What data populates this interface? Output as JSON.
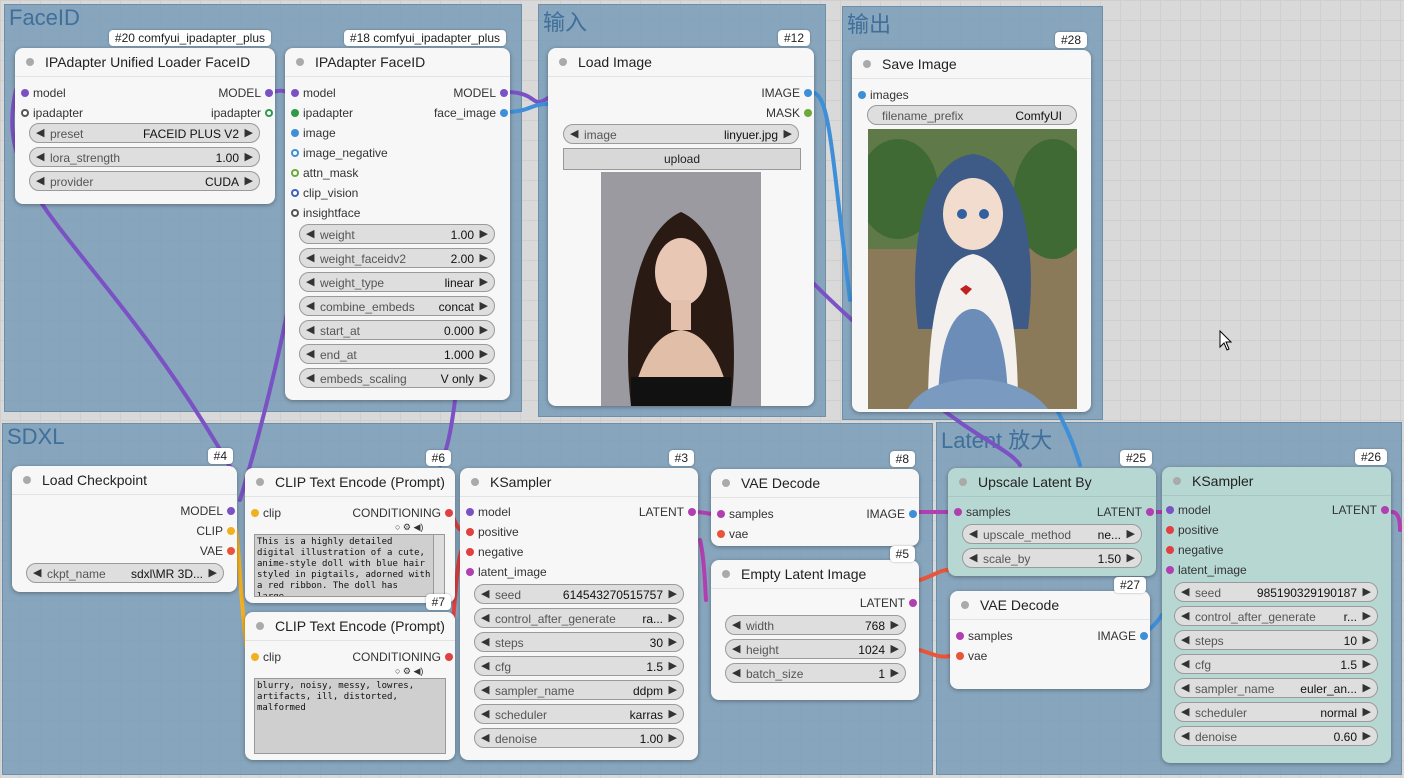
{
  "groups": {
    "faceid": "FaceID",
    "input": "输入",
    "output": "输出",
    "sdxl": "SDXL",
    "latent": "Latent 放大"
  },
  "colors": {
    "model": "#7b52c4",
    "ipadapter": "#2e9a4a",
    "image": "#3e8fd8",
    "clip": "#f0b020",
    "vae": "#e8553a",
    "conditioning": "#e04040",
    "latent": "#b040b0",
    "mask": "#6aaa3a"
  },
  "loader": {
    "badge": "#20 comfyui_ipadapter_plus",
    "title": "IPAdapter Unified Loader FaceID",
    "in_model": "model",
    "in_ipadapter": "ipadapter",
    "out_model": "MODEL",
    "out_ipadapter": "ipadapter",
    "w": [
      {
        "label": "preset",
        "value": "FACEID PLUS V2"
      },
      {
        "label": "lora_strength",
        "value": "1.00"
      },
      {
        "label": "provider",
        "value": "CUDA"
      }
    ]
  },
  "faceid": {
    "badge": "#18 comfyui_ipadapter_plus",
    "title": "IPAdapter FaceID",
    "inputs": [
      "model",
      "ipadapter",
      "image",
      "image_negative",
      "attn_mask",
      "clip_vision",
      "insightface"
    ],
    "out_model": "MODEL",
    "out_face": "face_image",
    "w": [
      {
        "label": "weight",
        "value": "1.00"
      },
      {
        "label": "weight_faceidv2",
        "value": "2.00"
      },
      {
        "label": "weight_type",
        "value": "linear"
      },
      {
        "label": "combine_embeds",
        "value": "concat"
      },
      {
        "label": "start_at",
        "value": "0.000"
      },
      {
        "label": "end_at",
        "value": "1.000"
      },
      {
        "label": "embeds_scaling",
        "value": "V only"
      }
    ]
  },
  "load_image": {
    "badge": "#12",
    "title": "Load Image",
    "out_image": "IMAGE",
    "out_mask": "MASK",
    "image_label": "image",
    "image_value": "linyuer.jpg",
    "upload": "upload"
  },
  "save_image": {
    "badge": "#28",
    "title": "Save Image",
    "in_images": "images",
    "prefix_label": "filename_prefix",
    "prefix_value": "ComfyUI"
  },
  "checkpoint": {
    "badge": "#4",
    "title": "Load Checkpoint",
    "out_model": "MODEL",
    "out_clip": "CLIP",
    "out_vae": "VAE",
    "ckpt_label": "ckpt_name",
    "ckpt_value": "sdxl\\MR 3D..."
  },
  "clip_pos": {
    "badge": "#6",
    "title": "CLIP Text Encode (Prompt)",
    "in_clip": "clip",
    "out": "CONDITIONING",
    "text": "This is a highly detailed digital illustration of a cute, anime-style doll with blue hair styled in pigtails, adorned with a red ribbon. The doll has large,"
  },
  "clip_neg": {
    "badge": "#7",
    "title": "CLIP Text Encode (Prompt)",
    "in_clip": "clip",
    "out": "CONDITIONING",
    "text": "blurry, noisy, messy, lowres, artifacts, ill, distorted, malformed"
  },
  "ksampler1": {
    "badge": "#3",
    "title": "KSampler",
    "inputs": [
      "model",
      "positive",
      "negative",
      "latent_image"
    ],
    "out": "LATENT",
    "w": [
      {
        "label": "seed",
        "value": "614543270515757"
      },
      {
        "label": "control_after_generate",
        "value": "ra..."
      },
      {
        "label": "steps",
        "value": "30"
      },
      {
        "label": "cfg",
        "value": "1.5"
      },
      {
        "label": "sampler_name",
        "value": "ddpm"
      },
      {
        "label": "scheduler",
        "value": "karras"
      },
      {
        "label": "denoise",
        "value": "1.00"
      }
    ]
  },
  "vae_decode1": {
    "badge": "#8",
    "title": "VAE Decode",
    "in_samples": "samples",
    "in_vae": "vae",
    "out": "IMAGE"
  },
  "empty_latent": {
    "badge": "#5",
    "title": "Empty Latent Image",
    "out": "LATENT",
    "w": [
      {
        "label": "width",
        "value": "768"
      },
      {
        "label": "height",
        "value": "1024"
      },
      {
        "label": "batch_size",
        "value": "1"
      }
    ]
  },
  "upscale": {
    "badge": "#25",
    "title": "Upscale Latent By",
    "in_samples": "samples",
    "out": "LATENT",
    "w": [
      {
        "label": "upscale_method",
        "value": "ne..."
      },
      {
        "label": "scale_by",
        "value": "1.50"
      }
    ]
  },
  "vae_decode2": {
    "badge": "#27",
    "title": "VAE Decode",
    "in_samples": "samples",
    "in_vae": "vae",
    "out": "IMAGE"
  },
  "ksampler2": {
    "badge": "#26",
    "title": "KSampler",
    "inputs": [
      "model",
      "positive",
      "negative",
      "latent_image"
    ],
    "out": "LATENT",
    "w": [
      {
        "label": "seed",
        "value": "985190329190187"
      },
      {
        "label": "control_after_generate",
        "value": "r..."
      },
      {
        "label": "steps",
        "value": "10"
      },
      {
        "label": "cfg",
        "value": "1.5"
      },
      {
        "label": "sampler_name",
        "value": "euler_an..."
      },
      {
        "label": "scheduler",
        "value": "normal"
      },
      {
        "label": "denoise",
        "value": "0.60"
      }
    ]
  }
}
